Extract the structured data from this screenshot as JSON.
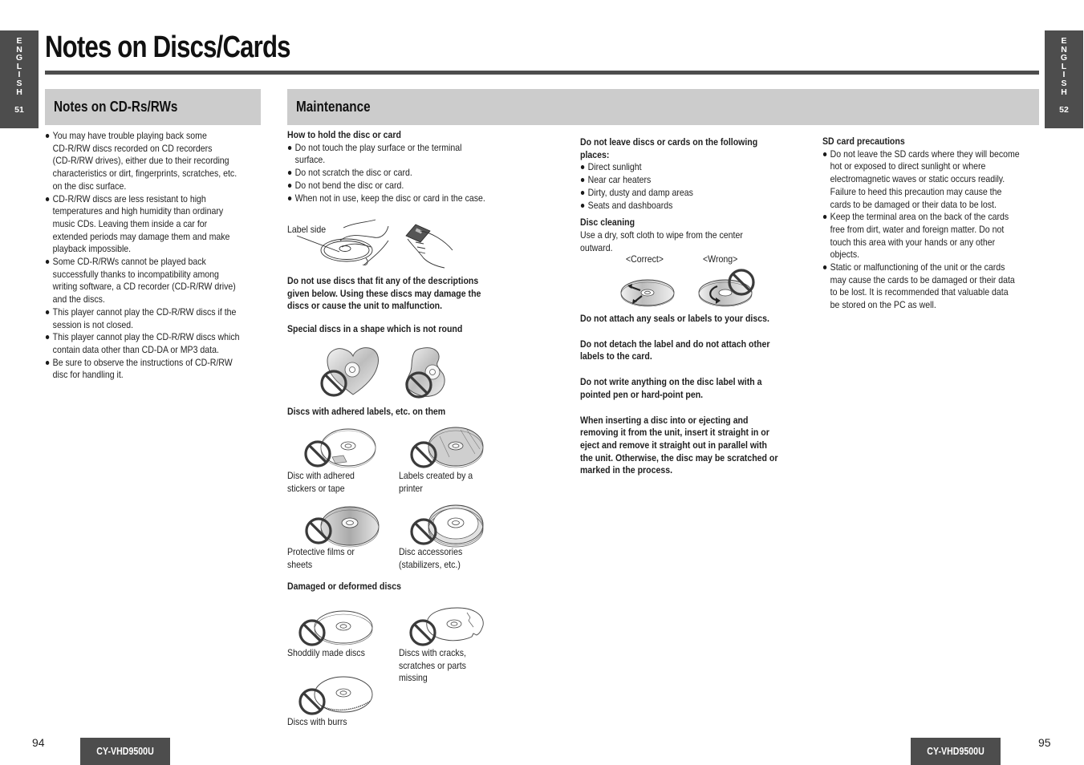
{
  "side_tabs": {
    "left": {
      "letters": [
        "E",
        "N",
        "G",
        "L",
        "I",
        "S",
        "H"
      ],
      "page": "51"
    },
    "right": {
      "letters": [
        "E",
        "N",
        "G",
        "L",
        "I",
        "S",
        "H"
      ],
      "page": "52"
    }
  },
  "page_title": "Notes on Discs/Cards",
  "cdr_section": {
    "heading": "Notes on CD-Rs/RWs",
    "bullets": [
      [
        "You may have trouble playing back some",
        "CD-R/RW discs recorded on CD recorders",
        "(CD-R/RW drives), either due to their recording",
        "characteristics or dirt, fingerprints, scratches, etc.",
        "on the disc surface."
      ],
      [
        "CD-R/RW discs are less resistant to high",
        "temperatures and high humidity than ordinary",
        "music CDs. Leaving them inside a car for",
        "extended periods may damage them and make",
        "playback impossible."
      ],
      [
        "Some CD-R/RWs cannot be played back",
        "successfully thanks to incompatibility among",
        "writing software, a CD recorder (CD-R/RW drive)",
        "and the discs."
      ],
      [
        "This player cannot play the CD-R/RW discs if the",
        "session is not closed."
      ],
      [
        "This player cannot play the CD-R/RW discs which",
        "contain data other than CD-DA or MP3 data."
      ],
      [
        "Be sure to observe the instructions of CD-R/RW",
        "disc for handling it."
      ]
    ]
  },
  "maintenance": {
    "heading": "Maintenance",
    "hold": {
      "title": "How to hold the disc or card",
      "bullets": [
        [
          "Do not touch the play surface or the terminal",
          "surface."
        ],
        [
          "Do not scratch the disc or card."
        ],
        [
          "Do not bend the disc or card."
        ],
        [
          "When not in use, keep the disc or card in the case."
        ]
      ],
      "illustration_label": "Label side"
    },
    "warning": [
      "Do not use discs that fit any of the descriptions",
      "given below. Using these discs may damage the",
      "discs or cause the unit to malfunction."
    ],
    "special_shape_title": "Special discs in a shape which is not round",
    "adhered_title": "Discs with adhered labels, etc. on them",
    "adhered_items": [
      [
        "Disc with adhered",
        "stickers or tape"
      ],
      [
        "Labels created by a",
        "printer"
      ],
      [
        "Protective films or",
        "sheets"
      ],
      [
        "Disc accessories",
        "(stabilizers, etc.)"
      ]
    ],
    "damaged_title": "Damaged or deformed discs",
    "damaged_items": [
      [
        "Shoddily made discs"
      ],
      [
        "Discs with cracks,",
        "scratches or parts",
        "missing"
      ],
      [
        "Discs with burrs"
      ]
    ],
    "places": {
      "title": [
        "Do not leave discs or cards on the following",
        "places:"
      ],
      "bullets": [
        "Direct sunlight",
        "Near car heaters",
        "Dirty, dusty and damp areas",
        "Seats and dashboards"
      ]
    },
    "cleaning": {
      "title": "Disc cleaning",
      "text": [
        "Use a dry, soft cloth to wipe from the center",
        "outward."
      ],
      "correct_label": "<Correct>",
      "wrong_label": "<Wrong>"
    },
    "notes": [
      [
        "Do not attach any seals or labels to your discs."
      ],
      [
        "Do not detach the label and do not attach other",
        "labels to the card."
      ],
      [
        "Do not write anything on the disc label with a",
        "pointed pen or hard-point pen."
      ],
      [
        "When inserting a disc into or ejecting and",
        "removing it from the unit, insert it straight in or",
        "eject and remove it straight out in parallel with",
        "the unit. Otherwise, the disc may be scratched or",
        "marked in the process."
      ]
    ],
    "sd": {
      "title": "SD card precautions",
      "bullets": [
        [
          "Do not leave the SD cards where they will  become",
          "hot or exposed to direct sunlight or where",
          "electromagnetic waves or static occurs readily.",
          "Failure to heed this precaution may cause the",
          "cards to be damaged or their data to be lost."
        ],
        [
          "Keep the terminal area on the back of the cards",
          "free from dirt, water and foreign matter. Do not",
          "touch this area with your hands or any other",
          "objects."
        ],
        [
          "Static or malfunctioning of the unit or the cards",
          "may cause the cards to be damaged or their data",
          "to be lost. It is recommended that valuable data",
          "be stored on the PC as well."
        ]
      ]
    }
  },
  "footer": {
    "left_page": "94",
    "right_page": "95",
    "model": "CY-VHD9500U"
  }
}
